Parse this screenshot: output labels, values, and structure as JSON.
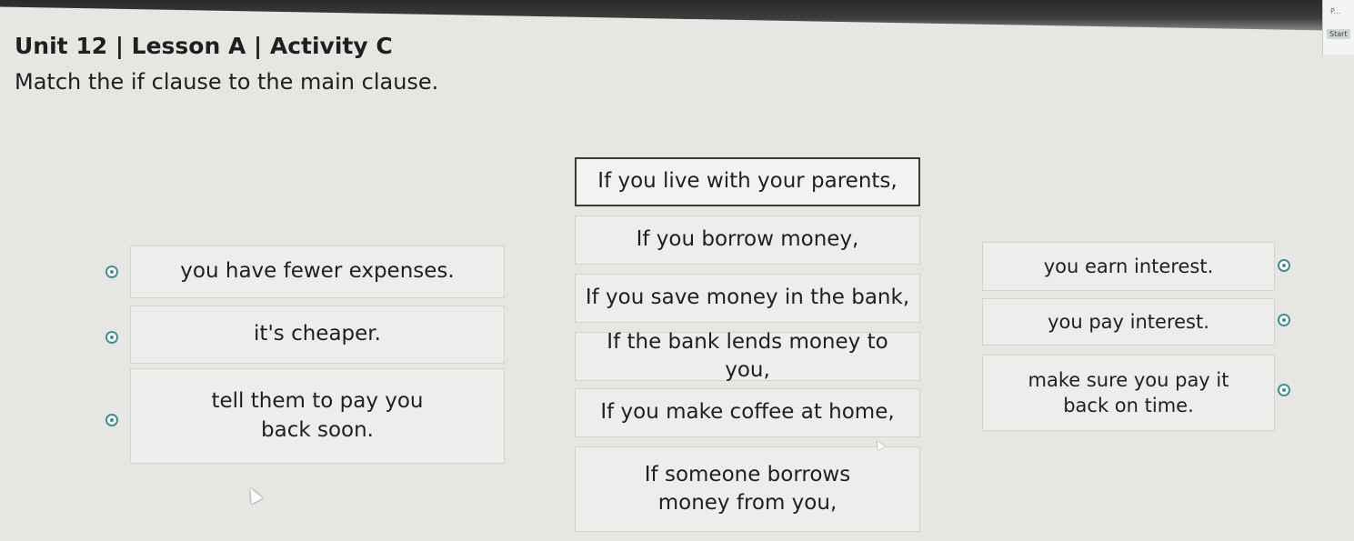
{
  "header": {
    "title": "Unit 12 | Lesson A | Activity C",
    "instruction": "Match the if clause to the main clause.",
    "start_label": "Start",
    "mini_label": "P..."
  },
  "if_clauses": [
    "If you live with your parents,",
    "If you borrow money,",
    "If you save money in the bank,",
    "If the bank lends money to you,",
    "If you make coffee at home,",
    "If someone borrows money from you,"
  ],
  "left_clauses": [
    "you have fewer expenses.",
    "it's cheaper.",
    "tell them to pay you back soon."
  ],
  "right_clauses": [
    "you earn interest.",
    "you pay interest.",
    "make sure you pay it back on time."
  ]
}
